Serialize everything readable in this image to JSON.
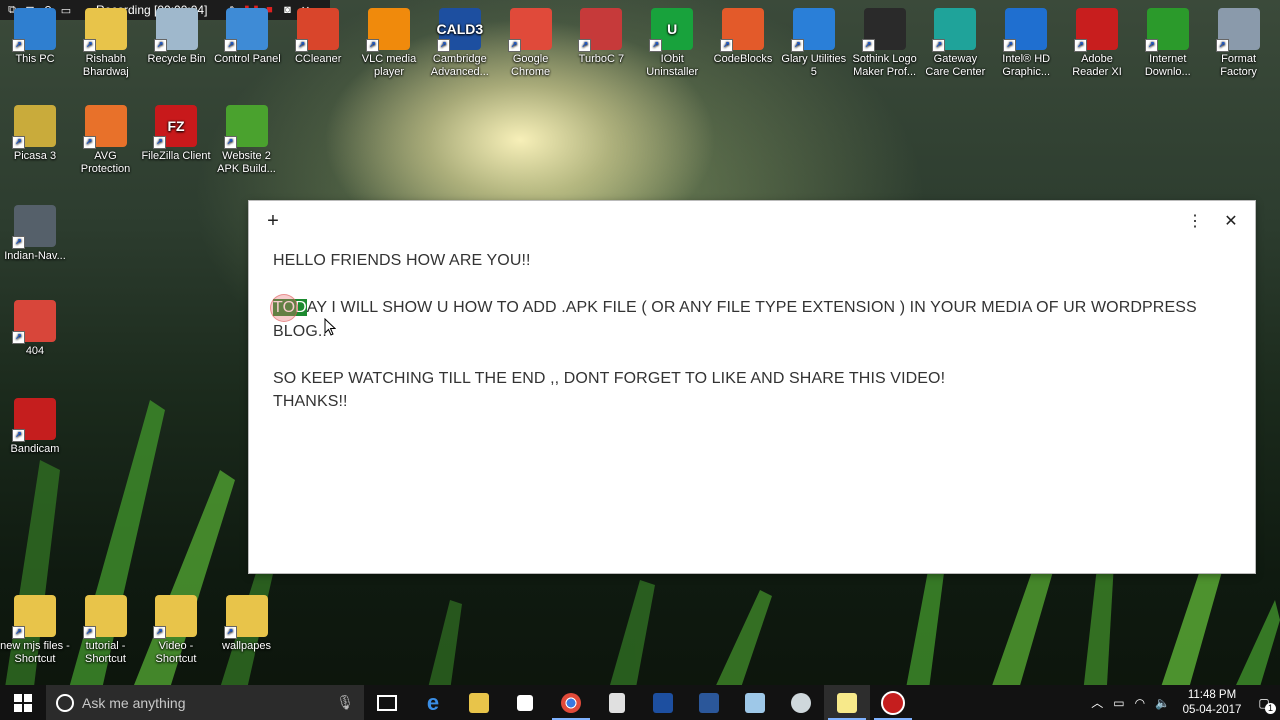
{
  "recorder": {
    "status": "Recording [00:00:04]"
  },
  "desktop": {
    "row1": [
      {
        "label": "This PC",
        "color": "#2f7fd0"
      },
      {
        "label": "Rishabh Bhardwaj",
        "color": "#e8c44a"
      },
      {
        "label": "Recycle Bin",
        "color": "#9fb8cc"
      },
      {
        "label": "Control Panel",
        "color": "#3e8bd6"
      },
      {
        "label": "CCleaner",
        "color": "#d9452b"
      },
      {
        "label": "VLC media player",
        "color": "#f08a0c"
      },
      {
        "label": "Cambridge Advanced...",
        "color": "#1d4fa0",
        "text": "CALD3"
      },
      {
        "label": "Google Chrome",
        "color": "#e04a3a"
      },
      {
        "label": "TurboC 7",
        "color": "#c63a3a"
      },
      {
        "label": "IObit Uninstaller",
        "color": "#18a23c",
        "text": "U"
      },
      {
        "label": "CodeBlocks",
        "color": "#e35a2a"
      },
      {
        "label": "Glary Utilities 5",
        "color": "#2a7fd8"
      },
      {
        "label": "Sothink Logo Maker Prof...",
        "color": "#2a2a2a"
      },
      {
        "label": "Gateway Care Center",
        "color": "#1fa39a"
      },
      {
        "label": "Intel® HD Graphic...",
        "color": "#1f6fd0"
      },
      {
        "label": "Adobe Reader XI",
        "color": "#c81e1e"
      },
      {
        "label": "Internet Downlo...",
        "color": "#2b9a2b"
      },
      {
        "label": "Format Factory",
        "color": "#8a9aab"
      }
    ],
    "row2": [
      {
        "label": "Picasa 3",
        "color": "#c9ab3b"
      },
      {
        "label": "AVG Protection",
        "color": "#e8712a"
      },
      {
        "label": "FileZilla Client",
        "color": "#c8191b",
        "text": "FZ"
      },
      {
        "label": "Website 2 APK Build...",
        "color": "#4aa22e"
      }
    ],
    "column": [
      {
        "label": "Indian-Nav...",
        "color": "#55606a"
      },
      {
        "label": "404",
        "color": "#d8463a"
      },
      {
        "label": "Bandicam",
        "color": "#c51e1e"
      }
    ],
    "bottom": [
      {
        "label": "new mjs files - Shortcut",
        "color": "#e8c44a"
      },
      {
        "label": "tutorial - Shortcut",
        "color": "#e8c44a"
      },
      {
        "label": "Video - Shortcut",
        "color": "#e8c44a"
      },
      {
        "label": "wallpapes",
        "color": "#e8c44a"
      }
    ]
  },
  "note": {
    "line1": "HELLO FRIENDS HOW ARE YOU!!",
    "line2_highlight": "TOD",
    "line2_rest": "AY I WILL SHOW U HOW TO ADD .APK FILE ( OR ANY FILE TYPE EXTENSION ) IN YOUR MEDIA OF UR WORDPRESS BLOG..",
    "line3": "SO KEEP WATCHING TILL THE END ,, DONT FORGET TO LIKE AND SHARE THIS VIDEO!",
    "line4": "THANKS!!",
    "add_label": "+",
    "menu_label": "⋮",
    "close_label": "✕"
  },
  "taskbar": {
    "search_placeholder": "Ask me anything",
    "time": "11:48 PM",
    "date": "05-04-2017",
    "notification_count": "1"
  }
}
